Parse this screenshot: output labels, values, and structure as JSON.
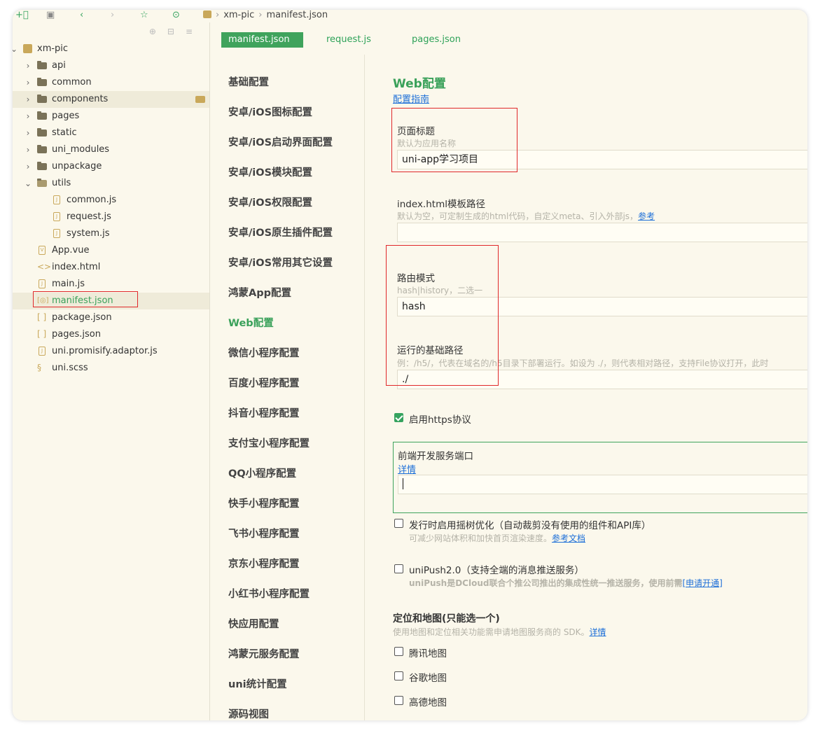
{
  "breadcrumb": {
    "project": "xm-pic",
    "file": "manifest.json"
  },
  "sidebar": {
    "project": "xm-pic",
    "items": [
      {
        "label": "api",
        "type": "folder"
      },
      {
        "label": "common",
        "type": "folder"
      },
      {
        "label": "components",
        "type": "folder"
      },
      {
        "label": "pages",
        "type": "folder"
      },
      {
        "label": "static",
        "type": "folder"
      },
      {
        "label": "uni_modules",
        "type": "folder"
      },
      {
        "label": "unpackage",
        "type": "folder"
      },
      {
        "label": "utils",
        "type": "folder-open"
      },
      {
        "label": "common.js",
        "type": "js"
      },
      {
        "label": "request.js",
        "type": "js"
      },
      {
        "label": "system.js",
        "type": "js"
      },
      {
        "label": "App.vue",
        "type": "vue"
      },
      {
        "label": "index.html",
        "type": "html"
      },
      {
        "label": "main.js",
        "type": "js"
      },
      {
        "label": "manifest.json",
        "type": "manifest"
      },
      {
        "label": "package.json",
        "type": "json"
      },
      {
        "label": "pages.json",
        "type": "json"
      },
      {
        "label": "uni.promisify.adaptor.js",
        "type": "js"
      },
      {
        "label": "uni.scss",
        "type": "scss"
      }
    ]
  },
  "tabs": [
    "manifest.json",
    "request.js",
    "pages.json"
  ],
  "nav": [
    "基础配置",
    "安卓/iOS图标配置",
    "安卓/iOS启动界面配置",
    "安卓/iOS模块配置",
    "安卓/iOS权限配置",
    "安卓/iOS原生插件配置",
    "安卓/iOS常用其它设置",
    "鸿蒙App配置",
    "Web配置",
    "微信小程序配置",
    "百度小程序配置",
    "抖音小程序配置",
    "支付宝小程序配置",
    "QQ小程序配置",
    "快手小程序配置",
    "飞书小程序配置",
    "京东小程序配置",
    "小红书小程序配置",
    "快应用配置",
    "鸿蒙元服务配置",
    "uni统计配置",
    "源码视图"
  ],
  "web": {
    "title": "Web配置",
    "guide_link": "配置指南",
    "page_title_label": "页面标题",
    "page_title_hint": "默认为应用名称",
    "page_title_value": "uni-app学习项目",
    "template_label": "index.html模板路径",
    "template_hint": "默认为空，可定制生成的html代码，自定义meta、引入外部js，",
    "template_hint_link": "参考",
    "template_value": "",
    "router_label": "路由模式",
    "router_hint": "hash|history，二选一",
    "router_value": "hash",
    "base_label": "运行的基础路径",
    "base_hint": "例：/h5/，代表在域名的/h5目录下部署运行。如设为 ./，则代表相对路径，支持File协议打开，此时",
    "base_value": "./",
    "https_label": "启用https协议",
    "port_label": "前端开发服务端口",
    "port_link": "详情",
    "port_value": "",
    "treeshake_label": "发行时启用摇树优化（自动裁剪没有使用的组件和API库）",
    "treeshake_hint": "可减少网站体积和加快首页渲染速度。",
    "treeshake_link": "参考文档",
    "unipush_label": "uniPush2.0（支持全端的消息推送服务）",
    "unipush_hint": "uniPush是DCloud联合个推公司推出的集成性统一推送服务，使用前需",
    "unipush_link": "[申请开通]",
    "map_title": "定位和地图(只能选一个)",
    "map_hint": "使用地图和定位相关功能需申请地图服务商的 SDK。",
    "map_link": "详情",
    "map_options": [
      "腾讯地图",
      "谷歌地图",
      "高德地图"
    ]
  },
  "colors": {
    "accent": "#3aa15a",
    "highlight": "#e0282a",
    "link": "#1d6fd8",
    "background": "#fbf8ec"
  }
}
